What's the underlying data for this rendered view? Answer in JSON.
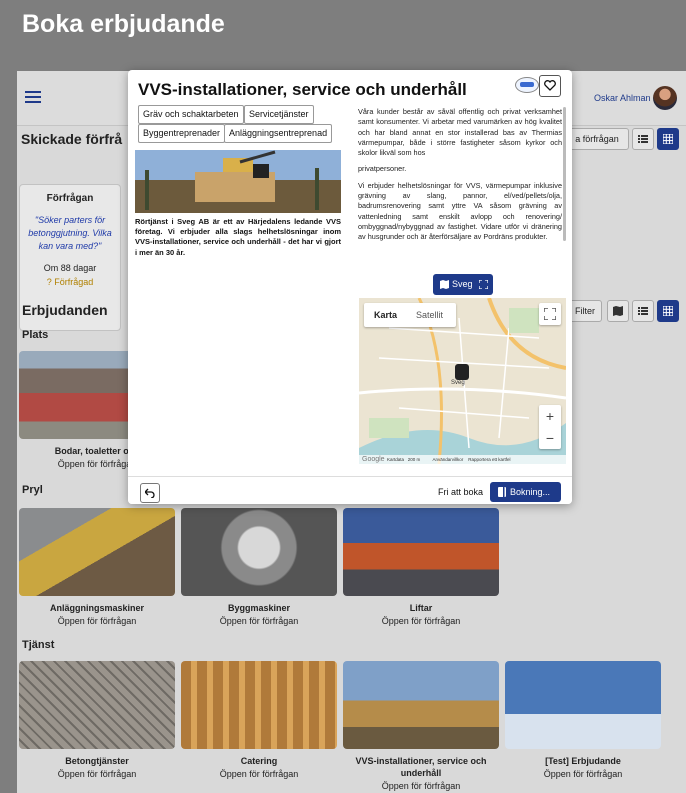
{
  "page": {
    "title": "Boka erbjudande"
  },
  "header": {
    "user_name": "Oskar Ahlman"
  },
  "sent_requests": {
    "title": "Skickade förfrå",
    "request_button": "a förfrågan",
    "card": {
      "heading": "Förfrågan",
      "quote": "\"Söker parters för betonggjutning. Vilka kan vara med?\"",
      "days": "Om 88 dagar",
      "status": "Förfrågad"
    }
  },
  "offers": {
    "title": "Erbjudanden",
    "filter_label": "Filter"
  },
  "categories": {
    "place": "Plats",
    "gear": "Pryl",
    "service": "Tjänst"
  },
  "cards": [
    {
      "title": "Bodar, toaletter och",
      "subtitle": "Öppen för förfrågan"
    },
    {
      "title": "Anläggningsmaskiner",
      "subtitle": "Öppen för förfrågan"
    },
    {
      "title": "Byggmaskiner",
      "subtitle": "Öppen för förfrågan"
    },
    {
      "title": "Liftar",
      "subtitle": "Öppen för förfrågan"
    },
    {
      "title": "Betongtjänster",
      "subtitle": "Öppen för förfrågan"
    },
    {
      "title": "Catering",
      "subtitle": "Öppen för förfrågan"
    },
    {
      "title": "VVS-installationer, service och underhåll",
      "subtitle": "Öppen för förfrågan"
    },
    {
      "title": "[Test] Erbjudande",
      "subtitle": "Öppen för förfrågan"
    }
  ],
  "modal": {
    "title": "VVS-installationer, service och underhåll",
    "tags": [
      "Gräv och schaktarbeten",
      "Servicetjänster",
      "Byggentreprenader",
      "Anläggningsentreprenad"
    ],
    "description": "Rörtjänst i Sveg AB är ett av Härjedalens ledande VVS företag. Vi erbjuder alla slags helhetslösningar inom VVS-installationer, service och underhåll - det har vi gjort i mer än 30 år.",
    "paragraphs": [
      "Våra kunder består av såväl offentlig och privat verksamhet samt konsumenter. Vi arbetar med varumärken av hög kvalitet och har bland annat en stor installerad bas av Thermias värmepumpar, både i större fastigheter såsom kyrkor och skolor likväl som hos",
      "privatpersoner.",
      "Vi erbjuder helhetslösningar för VVS, värmepumpar inklusive grävning av slang, pannor, el/ved/pellets/olja, badrumsrenovering samt yttre VA såsom grävning av vattenledning samt enskilt avlopp och renovering/ ombyggnad/nybyggnad av fastighet. Vidare utför vi dränering av husgrunder och är återförsäljare av Pordräns produkter."
    ],
    "city_button": "Sveg",
    "map": {
      "type_map": "Karta",
      "type_satellite": "Satellit",
      "zoom_in": "+",
      "zoom_out": "−",
      "marker_label": "Sveg",
      "google": "Google",
      "footer": "Kartdata   200 m          Användarvillkor    Rapportera ett kartfel"
    },
    "footer": {
      "free_label": "Fri att boka",
      "book_button": "Bokning..."
    }
  }
}
